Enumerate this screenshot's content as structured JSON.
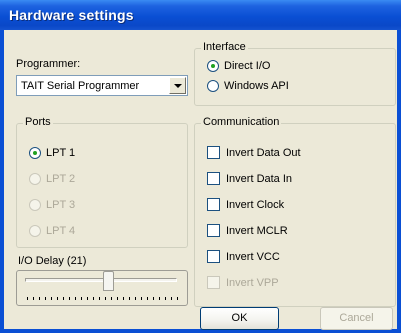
{
  "window": {
    "title": "Hardware settings"
  },
  "programmer": {
    "label": "Programmer:",
    "selected": "TAIT Serial Programmer"
  },
  "interface": {
    "title": "Interface",
    "options": [
      {
        "label": "Direct I/O",
        "selected": true
      },
      {
        "label": "Windows API",
        "selected": false
      }
    ]
  },
  "ports": {
    "title": "Ports",
    "options": [
      {
        "label": "LPT 1",
        "selected": true,
        "enabled": true
      },
      {
        "label": "LPT 2",
        "selected": false,
        "enabled": false
      },
      {
        "label": "LPT 3",
        "selected": false,
        "enabled": false
      },
      {
        "label": "LPT 4",
        "selected": false,
        "enabled": false
      }
    ]
  },
  "communication": {
    "title": "Communication",
    "options": [
      {
        "label": "Invert Data Out",
        "checked": false,
        "enabled": true
      },
      {
        "label": "Invert Data In",
        "checked": false,
        "enabled": true
      },
      {
        "label": "Invert Clock",
        "checked": false,
        "enabled": true
      },
      {
        "label": "Invert MCLR",
        "checked": false,
        "enabled": true
      },
      {
        "label": "Invert VCC",
        "checked": false,
        "enabled": true
      },
      {
        "label": "Invert VPP",
        "checked": false,
        "enabled": false
      }
    ]
  },
  "io_delay": {
    "label": "I/O Delay (21)",
    "value": 21
  },
  "buttons": {
    "ok": "OK",
    "cancel": "Cancel"
  }
}
